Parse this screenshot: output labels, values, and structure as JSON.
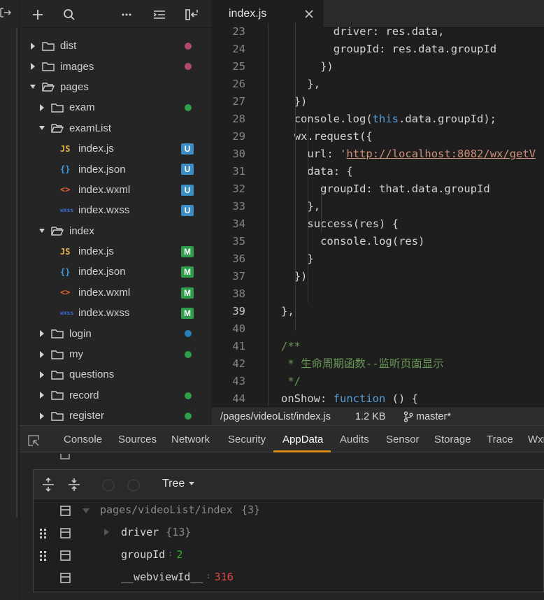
{
  "explorer": {
    "toolbar": {
      "icons": [
        "add-icon",
        "search-icon",
        "more-icon",
        "collapse-icon",
        "split-icon"
      ]
    },
    "tree": [
      {
        "label": "dist",
        "type": "folder",
        "indent": 0,
        "expanded": false,
        "status": "dot",
        "color": "#b04a6a"
      },
      {
        "label": "images",
        "type": "folder",
        "indent": 0,
        "expanded": false,
        "status": "dot",
        "color": "#b04a6a"
      },
      {
        "label": "pages",
        "type": "folder",
        "indent": 0,
        "expanded": true,
        "status": ""
      },
      {
        "label": "exam",
        "type": "folder",
        "indent": 1,
        "expanded": false,
        "status": "dot",
        "color": "#2e9e48"
      },
      {
        "label": "examList",
        "type": "folder",
        "indent": 1,
        "expanded": true,
        "status": ""
      },
      {
        "label": "index.js",
        "type": "file",
        "icon": "JS",
        "iconColor": "#e5b34a",
        "indent": 2,
        "status": "badge",
        "badge": "U",
        "color": "#3c8dc5"
      },
      {
        "label": "index.json",
        "type": "file",
        "icon": "{}",
        "iconColor": "#3b9be0",
        "indent": 2,
        "status": "badge",
        "badge": "U",
        "color": "#3c8dc5"
      },
      {
        "label": "index.wxml",
        "type": "file",
        "icon": "<>",
        "iconColor": "#e0622e",
        "indent": 2,
        "status": "badge",
        "badge": "U",
        "color": "#3c8dc5"
      },
      {
        "label": "index.wxss",
        "type": "file",
        "icon": "wxss",
        "iconColor": "#3b6fe0",
        "indent": 2,
        "status": "badge",
        "badge": "U",
        "color": "#3c8dc5"
      },
      {
        "label": "index",
        "type": "folder",
        "indent": 1,
        "expanded": true,
        "status": ""
      },
      {
        "label": "index.js",
        "type": "file",
        "icon": "JS",
        "iconColor": "#e5b34a",
        "indent": 2,
        "status": "badge",
        "badge": "M",
        "color": "#2e9e48"
      },
      {
        "label": "index.json",
        "type": "file",
        "icon": "{}",
        "iconColor": "#3b9be0",
        "indent": 2,
        "status": "badge",
        "badge": "M",
        "color": "#2e9e48"
      },
      {
        "label": "index.wxml",
        "type": "file",
        "icon": "<>",
        "iconColor": "#e0622e",
        "indent": 2,
        "status": "badge",
        "badge": "M",
        "color": "#2e9e48"
      },
      {
        "label": "index.wxss",
        "type": "file",
        "icon": "wxss",
        "iconColor": "#3b6fe0",
        "indent": 2,
        "status": "badge",
        "badge": "M",
        "color": "#2e9e48"
      },
      {
        "label": "login",
        "type": "folder",
        "indent": 1,
        "expanded": false,
        "status": "dot",
        "color": "#2a7fb8"
      },
      {
        "label": "my",
        "type": "folder",
        "indent": 1,
        "expanded": false,
        "status": "dot",
        "color": "#2e9e48"
      },
      {
        "label": "questions",
        "type": "folder",
        "indent": 1,
        "expanded": false,
        "status": ""
      },
      {
        "label": "record",
        "type": "folder",
        "indent": 1,
        "expanded": false,
        "status": "dot",
        "color": "#2e9e48"
      },
      {
        "label": "register",
        "type": "folder",
        "indent": 1,
        "expanded": false,
        "status": "dot",
        "color": "#2e9e48"
      }
    ]
  },
  "editor": {
    "tab": {
      "name": "index.js"
    },
    "lines": [
      {
        "n": "23",
        "indent": 6,
        "segs": [
          [
            "driver: res.data,",
            "plain"
          ]
        ]
      },
      {
        "n": "24",
        "indent": 6,
        "segs": [
          [
            "groupId: res.data.groupId",
            "plain"
          ]
        ]
      },
      {
        "n": "25",
        "indent": 5,
        "segs": [
          [
            "})",
            "plain"
          ]
        ]
      },
      {
        "n": "26",
        "indent": 4,
        "segs": [
          [
            "},",
            "plain"
          ]
        ]
      },
      {
        "n": "27",
        "indent": 3,
        "segs": [
          [
            "})",
            "plain"
          ]
        ]
      },
      {
        "n": "28",
        "indent": 3,
        "segs": [
          [
            "console.log(",
            "plain"
          ],
          [
            "this",
            "this"
          ],
          [
            ".data.groupId);",
            "plain"
          ]
        ]
      },
      {
        "n": "29",
        "indent": 3,
        "segs": [
          [
            "wx.request({",
            "plain"
          ]
        ]
      },
      {
        "n": "30",
        "indent": 4,
        "segs": [
          [
            "url: ",
            "plain"
          ],
          [
            "'",
            "str"
          ],
          [
            "http://localhost:8082/wx/getV",
            "url"
          ]
        ]
      },
      {
        "n": "31",
        "indent": 4,
        "segs": [
          [
            "data: {",
            "plain"
          ]
        ]
      },
      {
        "n": "32",
        "indent": 5,
        "segs": [
          [
            "groupId: that.data.groupId",
            "plain"
          ]
        ]
      },
      {
        "n": "33",
        "indent": 4,
        "segs": [
          [
            "},",
            "plain"
          ]
        ]
      },
      {
        "n": "34",
        "indent": 4,
        "segs": [
          [
            "success(res) {",
            "plain"
          ]
        ]
      },
      {
        "n": "35",
        "indent": 5,
        "segs": [
          [
            "console.log(res)",
            "plain"
          ]
        ]
      },
      {
        "n": "36",
        "indent": 4,
        "segs": [
          [
            "}",
            "plain"
          ]
        ]
      },
      {
        "n": "37",
        "indent": 3,
        "segs": [
          [
            "})",
            "plain"
          ]
        ]
      },
      {
        "n": "38",
        "indent": 0,
        "segs": []
      },
      {
        "n": "39",
        "indent": 2,
        "segs": [
          [
            "},",
            "plain"
          ]
        ],
        "current": true
      },
      {
        "n": "40",
        "indent": 0,
        "segs": []
      },
      {
        "n": "41",
        "indent": 2,
        "segs": [
          [
            "/**",
            "com"
          ]
        ]
      },
      {
        "n": "42",
        "indent": 2,
        "segs": [
          [
            " * 生命周期函数--监听页面显示",
            "com"
          ]
        ]
      },
      {
        "n": "43",
        "indent": 2,
        "segs": [
          [
            " */",
            "com"
          ]
        ]
      },
      {
        "n": "44",
        "indent": 2,
        "segs": [
          [
            "onShow: ",
            "plain"
          ],
          [
            "function",
            "fn"
          ],
          [
            " () {",
            "plain"
          ]
        ]
      }
    ],
    "status": {
      "path": "/pages/videoList/index.js",
      "size": "1.2 KB",
      "branch": "master*"
    }
  },
  "devtools": {
    "tabs": [
      "Console",
      "Sources",
      "Network",
      "Security",
      "AppData",
      "Audits",
      "Sensor",
      "Storage",
      "Trace",
      "Wxm"
    ],
    "active_tab": "AppData",
    "appdata": {
      "mode": "Tree",
      "root": {
        "key": "pages/videoList/index",
        "count": "{3}"
      },
      "items": [
        {
          "key": "driver",
          "count": "{13}",
          "expandable": true
        },
        {
          "key": "groupId",
          "value": "2",
          "valueColor": "#2fb02f"
        },
        {
          "key": "__webviewId__",
          "value": "316",
          "valueColor": "#e04b4b"
        }
      ]
    }
  }
}
